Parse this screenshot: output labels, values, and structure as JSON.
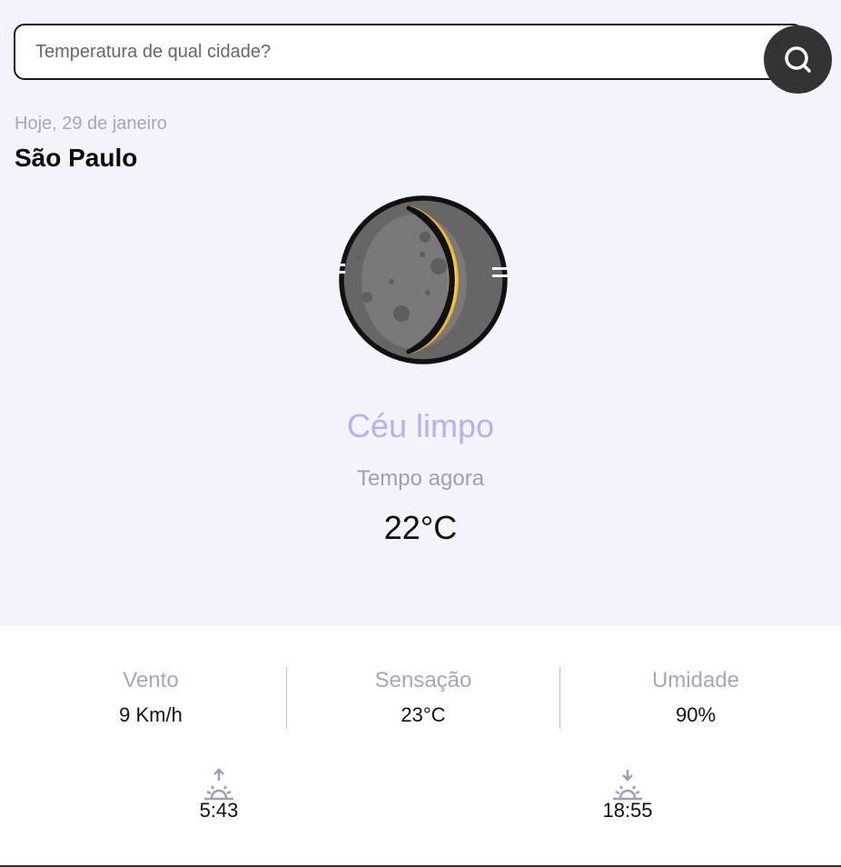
{
  "search": {
    "placeholder": "Temperatura de qual cidade?"
  },
  "header": {
    "date": "Hoje, 29 de janeiro",
    "city": "São Paulo"
  },
  "current": {
    "icon": "crescent-moon-icon",
    "condition": "Céu limpo",
    "label": "Tempo agora",
    "temperature": "22°C"
  },
  "stats": [
    {
      "label": "Vento",
      "value": "9 Km/h"
    },
    {
      "label": "Sensação",
      "value": "23°C"
    },
    {
      "label": "Umidade",
      "value": "90%"
    }
  ],
  "sun": {
    "sunrise": "5:43",
    "sunset": "18:55"
  },
  "colors": {
    "background_top": "#f3f3fb",
    "accent": "#b7b0f0",
    "muted": "#a5a5bf",
    "button": "#333333",
    "moon_gold": "#f9b233"
  }
}
